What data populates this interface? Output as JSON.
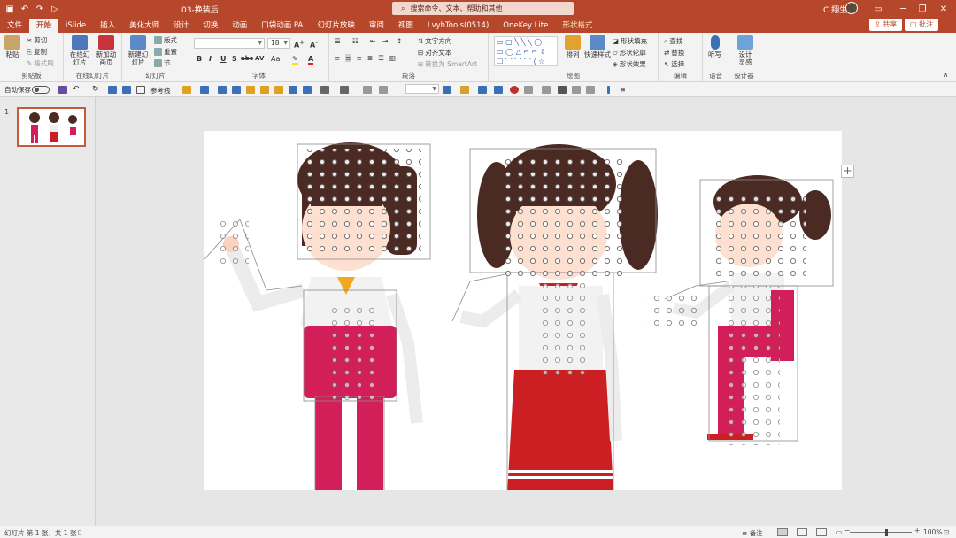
{
  "titlebar": {
    "doc_title": "03-换装后",
    "search_placeholder": "搜索命令、文本、帮助和其他",
    "user_name": "C 翔生",
    "icons": [
      "save-icon",
      "undo-icon",
      "redo-icon",
      "start-icon"
    ],
    "win_controls": [
      "ribbon-display-icon",
      "minimize-icon",
      "restore-icon",
      "close-icon"
    ]
  },
  "tabs": [
    "文件",
    "开始",
    "iSlide",
    "插入",
    "美化大师",
    "设计",
    "切换",
    "动画",
    "口袋动画 PA",
    "幻灯片放映",
    "审阅",
    "视图",
    "LvyhTools(0514)",
    "OneKey Lite",
    "形状格式"
  ],
  "active_tab": "开始",
  "share_label": "共享",
  "comment_label": "批注",
  "ribbon": {
    "clipboard": {
      "paste": "粘贴",
      "cut": "剪切",
      "copy": "复制",
      "format_painter": "格式刷",
      "label": "剪贴板"
    },
    "online": {
      "online_slide": "在线幻灯片",
      "new_anim": "新加动画页",
      "label": "在线幻灯片"
    },
    "slides": {
      "new_slide": "新建幻灯片",
      "layout": "版式",
      "reset": "重置",
      "section": "节",
      "label": "幻灯片"
    },
    "font": {
      "font_name": "",
      "font_size": "18",
      "bold": "B",
      "italic": "I",
      "underline": "U",
      "strike": "S",
      "spacing": "AV",
      "case": "Aa",
      "color": "A",
      "label": "字体"
    },
    "paragraph": {
      "text_dir": "文字方向",
      "align_text": "对齐文本",
      "smartart": "转换为 SmartArt",
      "label": "段落"
    },
    "drawing": {
      "arrange": "排列",
      "quick_styles": "快速样式",
      "fill": "形状填充",
      "outline": "形状轮廓",
      "effects": "形状效果",
      "label": "绘图"
    },
    "editing": {
      "find": "查找",
      "replace": "替换",
      "select": "选择",
      "label": "编辑"
    },
    "voice": {
      "dictate": "听写",
      "label": "语音"
    },
    "designer": {
      "ideas": "设计灵感",
      "label": "设计器"
    }
  },
  "qat": {
    "autosave": "自动保存",
    "toggle_state": "关",
    "reference_line": "参考线"
  },
  "thumbnail": {
    "number": "1"
  },
  "status": {
    "slide_info": "幻灯片 第 1 张，共 1 张",
    "notes": "备注",
    "zoom": "100%"
  },
  "colors": {
    "accent": "#b7472a",
    "pink": "#d21f5a",
    "red": "#cc1f23",
    "hair": "#4a2a22"
  }
}
